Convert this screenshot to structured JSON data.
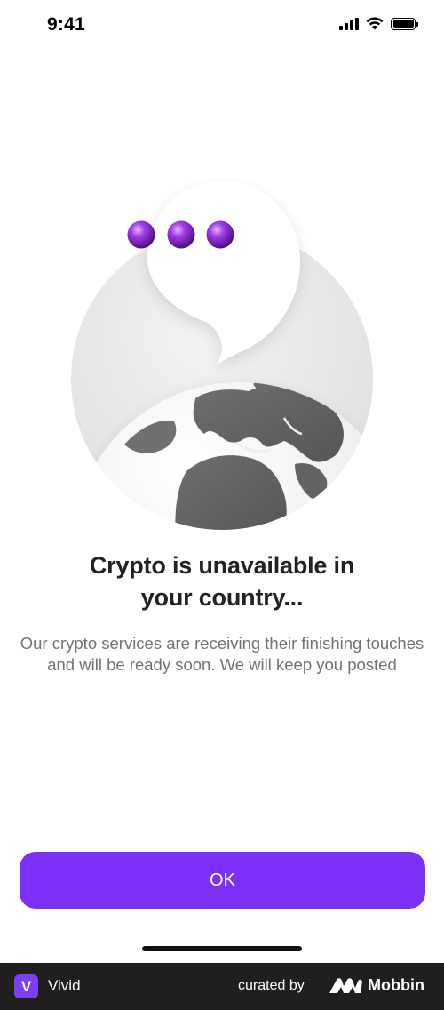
{
  "status_bar": {
    "time": "9:41",
    "icons": [
      "cellular-signal-icon",
      "wifi-icon",
      "battery-icon"
    ]
  },
  "illustration": {
    "description_icons": [
      "typing-dots-icon",
      "speech-bubble-icon",
      "globe-icon"
    ],
    "dot_color": "#8a2bd6"
  },
  "content": {
    "title_line1": "Crypto is unavailable in",
    "title_line2": "your country...",
    "description": "Our crypto services are receiving their finishing touches and will be ready soon. We will keep you posted"
  },
  "actions": {
    "ok_label": "OK",
    "button_color": "#7b2ff7"
  },
  "footer": {
    "app_logo_letter": "V",
    "app_name": "Vivid",
    "curated_by": "curated by",
    "platform": "Mobbin"
  }
}
